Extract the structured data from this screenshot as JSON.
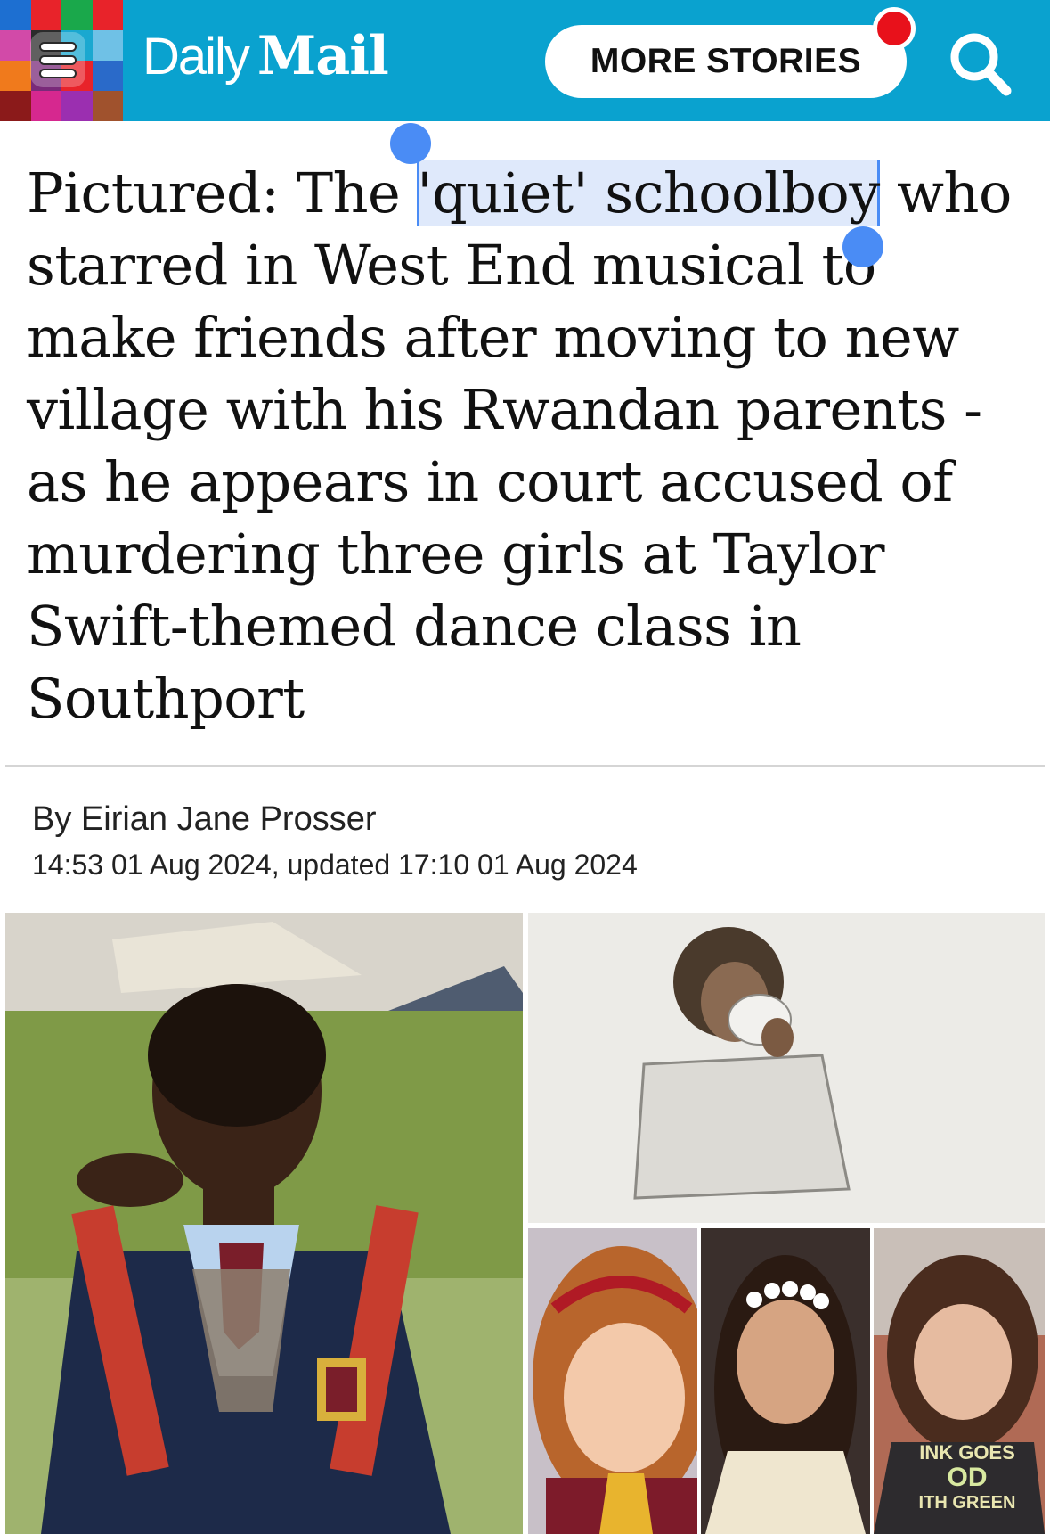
{
  "header": {
    "logo": {
      "daily": "Daily",
      "mail": "Mail"
    },
    "more_stories_label": "MORE STORIES",
    "colors": {
      "bar": "#0aa2cf",
      "notification": "#e8111b"
    },
    "icons": [
      "menu-icon",
      "search-icon",
      "notification-dot"
    ]
  },
  "article": {
    "headline": {
      "before": "Pictured: The ",
      "selected": "'quiet' schoolboy",
      "after": " who starred in West End musical to make friends after moving to new village with his Rwandan parents - as he appears in court accused of murdering three girls at Taylor Swift-themed dance class in Southport"
    },
    "byline": "By Eirian Jane Prosser",
    "timestamp": "14:53 01 Aug 2024, updated 17:10 01 Aug 2024",
    "shirt_text": {
      "line1": "INK GOES",
      "line2": "OD",
      "line3": "ITH GREEN"
    }
  }
}
